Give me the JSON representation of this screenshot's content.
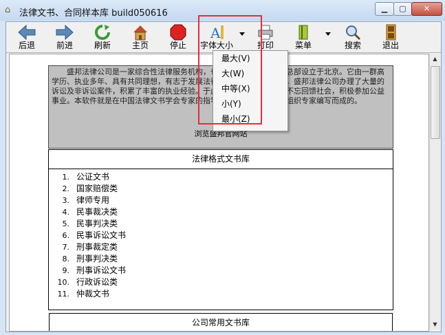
{
  "window": {
    "title": "法律文书、合同样本库 build050616",
    "app_icon": "house-icon",
    "controls": {
      "minimize": "minimize-icon",
      "maximize": "maximize-icon",
      "close": "close-icon"
    }
  },
  "toolbar": {
    "back": "后退",
    "forward": "前进",
    "refresh": "刷新",
    "home": "主页",
    "stop": "停止",
    "font_size": "字体大小",
    "print": "打印",
    "menu": "菜单",
    "search": "搜索",
    "exit": "退出"
  },
  "font_menu": {
    "items": [
      "最大(V)",
      "大(W)",
      "中等(X)",
      "小(Y)",
      "最小(Z)"
    ]
  },
  "intro": {
    "text": "　　盛邦法律公司是一家综合性法律服务机构，也是法律文书研究会，总部设立于北京。它由一群高学历、执业多年、具有共同理想，有志于发展法律事业的人士成立至今，盛邦法律公司办理了大量的诉讼及非诉讼案件，积累了丰富的执业经验。于此同时，盛邦法律公司不忘回馈社会，积极参加公益事业。本软件就是在中国法律文书学会专家的指导下，由盛邦法律公司组织专家编写而成的。",
    "link": "浏览盛邦官网站"
  },
  "sections": [
    {
      "title": "法律格式文书库",
      "items": [
        {
          "num": "1.",
          "label": "公证文书"
        },
        {
          "num": "2.",
          "label": "国家赔偿类"
        },
        {
          "num": "3.",
          "label": "律师专用"
        },
        {
          "num": "4.",
          "label": "民事裁决类"
        },
        {
          "num": "5.",
          "label": "民事判决类"
        },
        {
          "num": "6.",
          "label": "民事诉讼文书"
        },
        {
          "num": "7.",
          "label": "刑事裁定类"
        },
        {
          "num": "8.",
          "label": "刑事判决类"
        },
        {
          "num": "9.",
          "label": "刑事诉讼文书"
        },
        {
          "num": "10.",
          "label": "行政诉讼类"
        },
        {
          "num": "11.",
          "label": "仲裁文书"
        }
      ]
    },
    {
      "title": "公司常用文书库",
      "items": []
    }
  ],
  "colors": {
    "highlight_box": "#e0303a",
    "intro_bg": "#c0c0c0"
  }
}
